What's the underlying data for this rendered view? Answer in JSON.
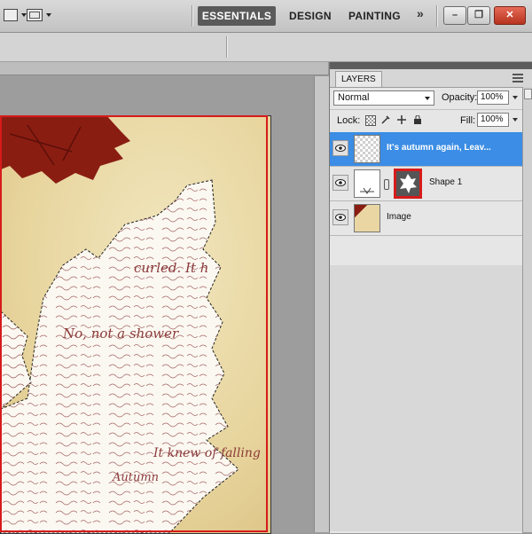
{
  "app": {
    "workspaces": [
      {
        "label": "ESSENTIALS",
        "active": true
      },
      {
        "label": "DESIGN",
        "active": false
      },
      {
        "label": "PAINTING",
        "active": false
      }
    ],
    "more_workspaces_glyph": "»",
    "window_buttons": {
      "minimize": "–",
      "restore": "❐",
      "close": "✕"
    },
    "icons": [
      "view-extras-icon",
      "screen-mode-icon",
      "chevron-down-icon"
    ]
  },
  "document": {
    "selection_border_color": "#d61b1b",
    "text_snippets": [
      "curled. It h",
      "No, not a shower",
      "It knew of falling",
      "Autumn"
    ]
  },
  "layers_panel": {
    "tab_label": "LAYERS",
    "blend_mode": "Normal",
    "opacity_label": "Opacity:",
    "opacity_value": "100%",
    "lock_label": "Lock:",
    "fill_label": "Fill:",
    "fill_value": "100%",
    "layers": [
      {
        "name": "It's autumn again, Leav...",
        "selected": true,
        "type": "text",
        "visible": true
      },
      {
        "name": "Shape 1",
        "selected": false,
        "type": "shape",
        "visible": true,
        "mask_highlighted": true
      },
      {
        "name": "Image",
        "selected": false,
        "type": "image",
        "visible": true
      }
    ],
    "selection_color": "#3b8de5"
  }
}
